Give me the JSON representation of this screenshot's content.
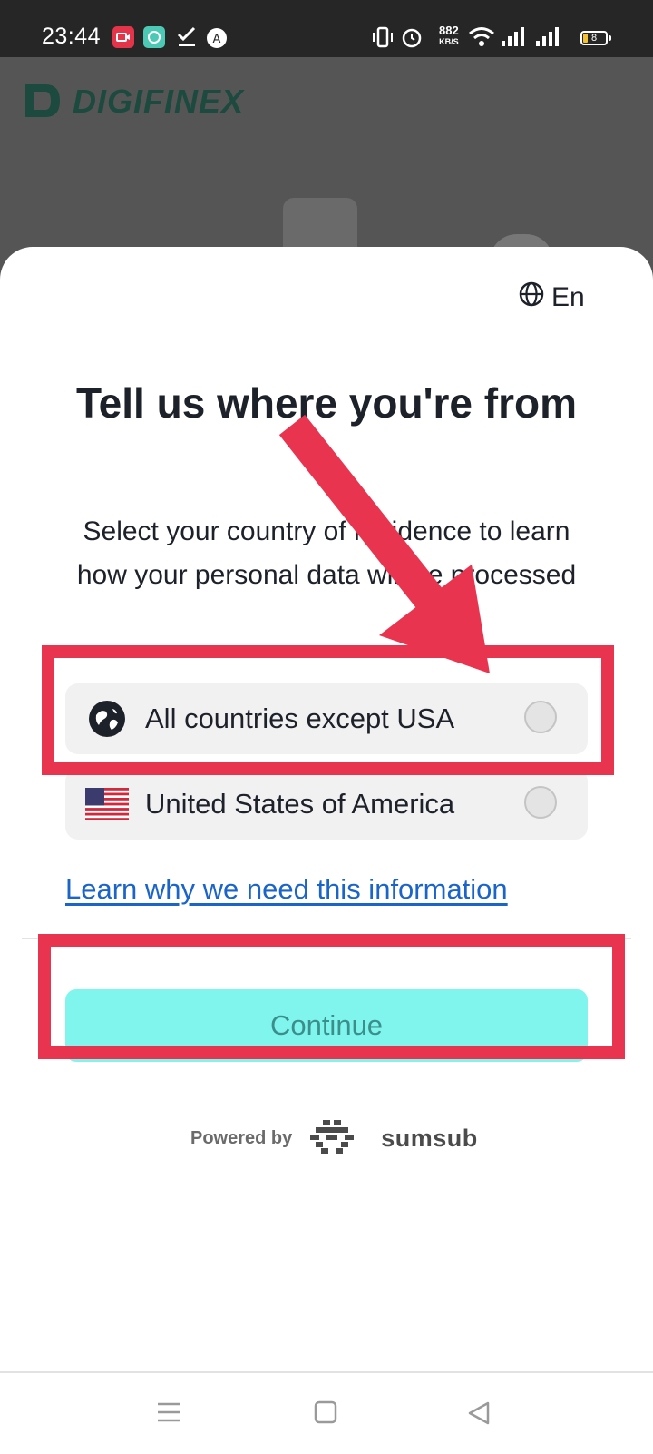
{
  "status_bar": {
    "time": "23:44",
    "net_speed": "882",
    "net_speed_unit": "KB/S",
    "battery": "8"
  },
  "background_app": {
    "brand": "DIGIFINEX"
  },
  "sheet": {
    "language_label": "En",
    "title": "Tell us where you're from",
    "subtitle": "Select your country of residence to learn how your personal data will be processed",
    "options": [
      {
        "label": "All countries except USA",
        "icon": "globe-filled-icon",
        "selected": false
      },
      {
        "label": "United States of America",
        "icon": "us-flag-icon",
        "selected": false
      }
    ],
    "learn_link": "Learn why we need this information",
    "continue_label": "Continue",
    "powered_by": "Powered by",
    "provider": "sumsub"
  },
  "colors": {
    "annotation": "#e8344e",
    "continue_bg": "#80f5ee",
    "link": "#1b64c9"
  }
}
